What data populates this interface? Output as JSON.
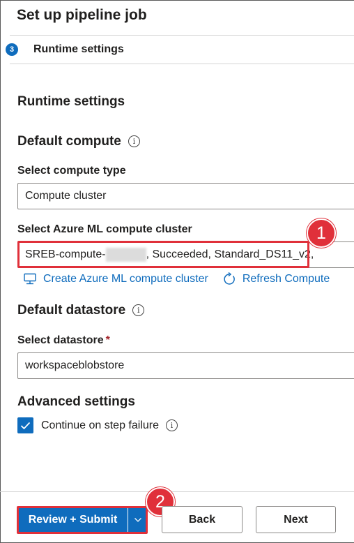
{
  "header": {
    "title": "Set up pipeline job"
  },
  "step": {
    "number": "3",
    "label": "Runtime settings"
  },
  "section": {
    "title": "Runtime settings"
  },
  "default_compute": {
    "heading": "Default compute",
    "compute_type_label": "Select compute type",
    "compute_type_value": "Compute cluster",
    "cluster_label": "Select Azure ML compute cluster",
    "cluster_value_prefix": "SREB-compute-",
    "cluster_value_suffix": ", Succeeded, Standard_DS11_v2,",
    "create_link": "Create Azure ML compute cluster",
    "refresh_link": "Refresh Compute"
  },
  "default_datastore": {
    "heading": "Default datastore",
    "datastore_label": "Select datastore",
    "required_mark": "*",
    "datastore_value": "workspaceblobstore"
  },
  "advanced": {
    "heading": "Advanced settings",
    "continue_on_failure_label": "Continue on step failure",
    "continue_on_failure_checked": true
  },
  "footer": {
    "review_submit": "Review + Submit",
    "back": "Back",
    "next": "Next"
  },
  "callouts": {
    "first": "1",
    "second": "2"
  },
  "colors": {
    "accent": "#0f6cbd",
    "callout": "#e0303a",
    "required": "#a4262c"
  },
  "icons": {
    "info": "info-icon",
    "compute": "computer-icon",
    "refresh": "refresh-icon",
    "check": "checkmark-icon",
    "chevron": "chevron-down-icon"
  }
}
